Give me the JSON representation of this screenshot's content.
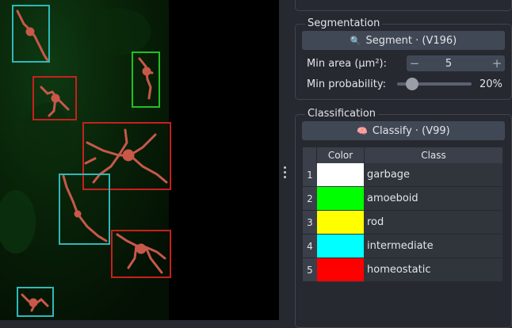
{
  "segmentation": {
    "title": "Segmentation",
    "segment_button": "Segment · (V196)",
    "segment_icon": "search-icon",
    "min_area_label": "Min area (µm²):",
    "min_area_value": "5",
    "minus": "−",
    "plus": "+",
    "min_prob_label": "Min probability:",
    "min_prob_value": "20%",
    "min_prob_fraction": 0.2
  },
  "classification": {
    "title": "Classification",
    "classify_button": "Classify · (V99)",
    "classify_icon": "brain-icon",
    "headers": {
      "color": "Color",
      "class": "Class"
    },
    "rows": [
      {
        "n": "1",
        "color": "#ffffff",
        "label": "garbage"
      },
      {
        "n": "2",
        "color": "#00ff00",
        "label": "amoeboid"
      },
      {
        "n": "3",
        "color": "#ffff00",
        "label": "rod"
      },
      {
        "n": "4",
        "color": "#00ffff",
        "label": "intermediate"
      },
      {
        "n": "5",
        "color": "#ff0000",
        "label": "homeostatic"
      }
    ]
  },
  "colors": {
    "roi_cyan": "#2fb8b8",
    "roi_red": "#c8201e",
    "roi_green": "#22c022",
    "cell_fill": "#c8584a"
  }
}
